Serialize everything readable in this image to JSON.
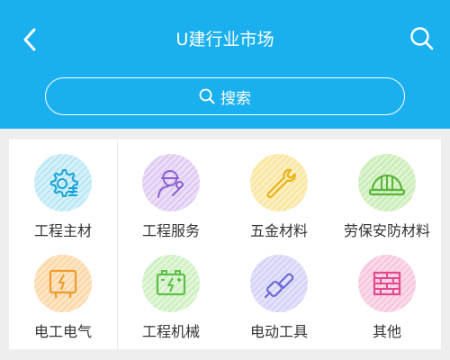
{
  "header": {
    "title": "U建行业市场",
    "back_icon": "chevron-left-icon",
    "search_icon": "search-icon",
    "background_color": "#1ab0ef"
  },
  "search": {
    "label": "搜索",
    "icon": "search-icon"
  },
  "categories": [
    {
      "label": "工程主材",
      "icon": "gear-list-icon",
      "color": "#1aa3d9"
    },
    {
      "label": "工程服务",
      "icon": "worker-wrench-icon",
      "color": "#8a5fd1"
    },
    {
      "label": "五金材料",
      "icon": "wrench-icon",
      "color": "#e8b416"
    },
    {
      "label": "劳保安防材料",
      "icon": "safety-helmet-icon",
      "color": "#5bb53a"
    },
    {
      "label": "电工电气",
      "icon": "electrical-panel-icon",
      "color": "#f09a2a"
    },
    {
      "label": "工程机械",
      "icon": "battery-icon",
      "color": "#5cc046"
    },
    {
      "label": "电动工具",
      "icon": "chainsaw-icon",
      "color": "#6e6ad6"
    },
    {
      "label": "其他",
      "icon": "brick-wall-icon",
      "color": "#e2498d"
    }
  ]
}
